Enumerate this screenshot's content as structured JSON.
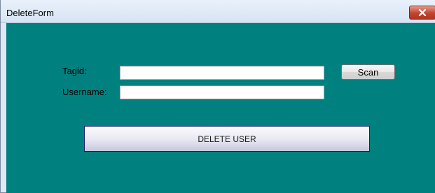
{
  "window": {
    "title": "DeleteForm",
    "close_icon": "close-icon"
  },
  "form": {
    "tagid_label": "Tagid:",
    "tagid_value": "",
    "username_label": "Username:",
    "username_value": "",
    "scan_label": "Scan",
    "delete_label": "DELETE USER"
  },
  "colors": {
    "client_background": "#018080",
    "title_bar": "#dfe9f5",
    "close_button": "#c1442f"
  }
}
